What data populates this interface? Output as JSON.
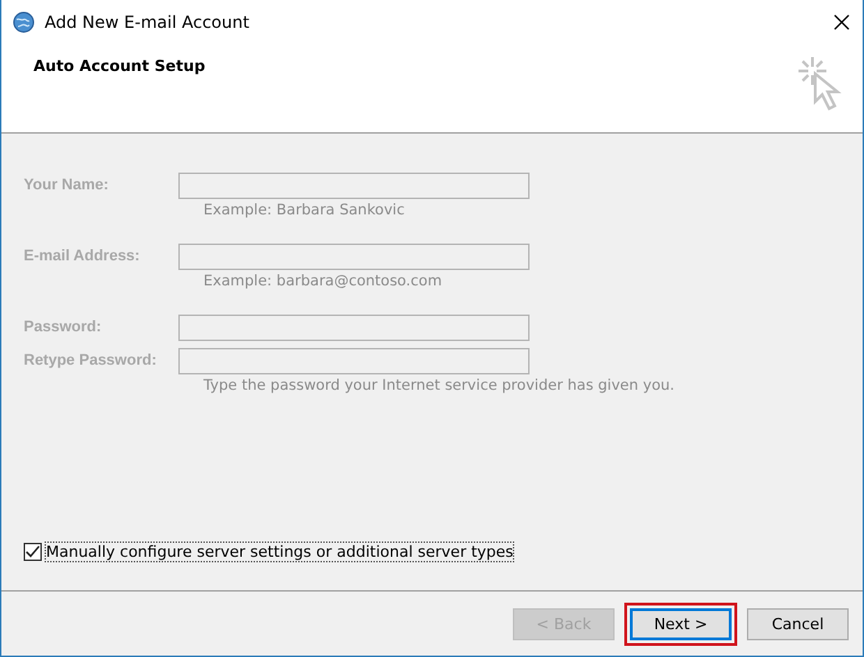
{
  "window": {
    "title": "Add New E-mail Account"
  },
  "header": {
    "title": "Auto Account Setup"
  },
  "fields": [
    {
      "label": "Your Name:",
      "disabled": true,
      "hint": "Example: Barbara Sankovic"
    },
    {
      "label": "E-mail Address:",
      "disabled": true,
      "hint": "Example: barbara@contoso.com"
    },
    {
      "label": "Password:",
      "disabled": true
    },
    {
      "label": "Retype Password:",
      "disabled": true,
      "hint": "Type the password your Internet service provider has given you."
    }
  ],
  "manual_checkbox": {
    "label": "Manually configure server settings or additional server types",
    "checked": true
  },
  "buttons": [
    {
      "label": "< Back",
      "disabled": true,
      "highlighted": false
    },
    {
      "label": "Next >",
      "disabled": false,
      "highlighted": true
    },
    {
      "label": "Cancel",
      "disabled": false,
      "highlighted": false
    }
  ]
}
